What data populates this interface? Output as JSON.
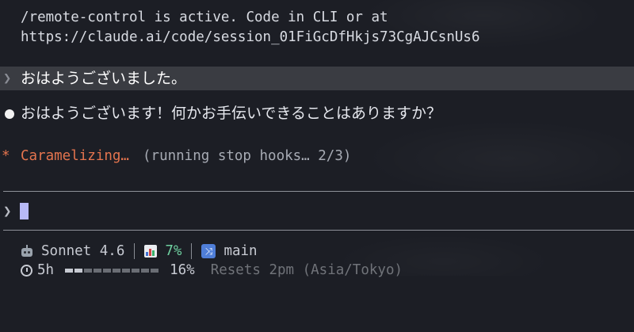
{
  "notice": {
    "line1": "/remote-control is active. Code in CLI or at",
    "line2": "https://claude.ai/code/session_01FiGcDfHkjs73CgAJCsnUs6"
  },
  "user_message": {
    "glyph": "❯",
    "text": "おはようございました。"
  },
  "assistant_message": {
    "text": "おはようございます！何かお手伝いできることはありますか？"
  },
  "status": {
    "glyph": "*",
    "word": "Caramelizing…",
    "detail": "(running stop hooks… 2/3)"
  },
  "input": {
    "glyph": "❯",
    "value": ""
  },
  "footer": {
    "model_icon": "robot-icon",
    "model": "Sonnet 4.6",
    "context_icon": "bar-chart-icon",
    "context_pct": "7%",
    "branch_icon": "shuffle-icon",
    "branch": "main",
    "timer_icon": "timer-icon",
    "time_left": "5h",
    "usage_fraction": 0.16,
    "usage_pct": "16%",
    "resets": "Resets 2pm (Asia/Tokyo)"
  },
  "colors": {
    "background": "#1c1e25",
    "accent": "#e4744e",
    "cursor": "#b7b9f5",
    "context_green": "#6fd0a0",
    "branch_blue": "#4f7ed8"
  }
}
